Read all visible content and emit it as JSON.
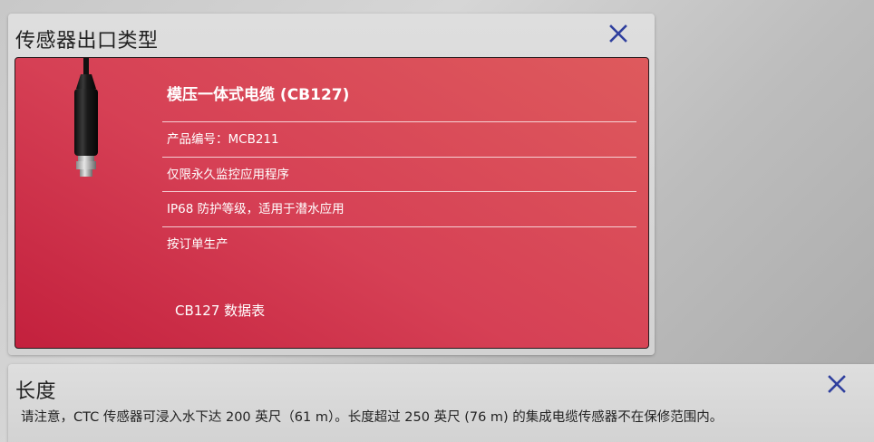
{
  "outlet_panel": {
    "title": "传感器出口类型",
    "close_icon": "close-icon",
    "product": {
      "name": "模压一体式电缆 (CB127)",
      "details": [
        "产品编号：MCB211",
        "仅限永久监控应用程序",
        "IP68 防护等级，适用于潜水应用",
        "按订单生产"
      ],
      "datasheet_label": "CB127 数据表"
    }
  },
  "length_panel": {
    "title": "长度",
    "close_icon": "close-icon",
    "note": "请注意，CTC 传感器可浸入水下达 200 英尺（61 m）。长度超过 250 英尺 (76 m) 的集成电缆传感器不在保修范围内。"
  },
  "colors": {
    "card_gradient_start": "#c3203d",
    "card_gradient_end": "#de5a5d",
    "close_icon": "#2f3f9e"
  }
}
